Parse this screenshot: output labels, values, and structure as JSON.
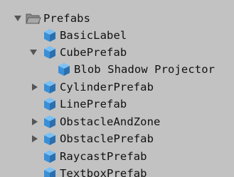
{
  "hierarchy": {
    "root": {
      "label": "Prefabs",
      "icon": "folder-open-icon",
      "expanded": true
    },
    "items": [
      {
        "label": "BasicLabel",
        "icon": "prefab-cube-icon",
        "expandable": false
      },
      {
        "label": "CubePrefab",
        "icon": "prefab-cube-icon",
        "expandable": true,
        "expanded": true,
        "children": [
          {
            "label": "Blob Shadow Projector",
            "icon": "prefab-cube-icon",
            "expandable": false
          }
        ]
      },
      {
        "label": "CylinderPrefab",
        "icon": "prefab-cube-icon",
        "expandable": true,
        "expanded": false
      },
      {
        "label": "LinePrefab",
        "icon": "prefab-cube-icon",
        "expandable": false
      },
      {
        "label": "ObstacleAndZone",
        "icon": "prefab-cube-icon",
        "expandable": true,
        "expanded": false
      },
      {
        "label": "ObstaclePrefab",
        "icon": "prefab-cube-icon",
        "expandable": true,
        "expanded": false
      },
      {
        "label": "RaycastPrefab",
        "icon": "prefab-cube-icon",
        "expandable": false
      },
      {
        "label": "TextboxPrefab",
        "icon": "prefab-cube-icon",
        "expandable": false
      }
    ]
  },
  "colors": {
    "background": "#c2c2c2",
    "text": "#111111",
    "prefab_blue": "#3b8fd6",
    "folder_gray": "#7a7a7a",
    "arrow_gray": "#555555"
  }
}
